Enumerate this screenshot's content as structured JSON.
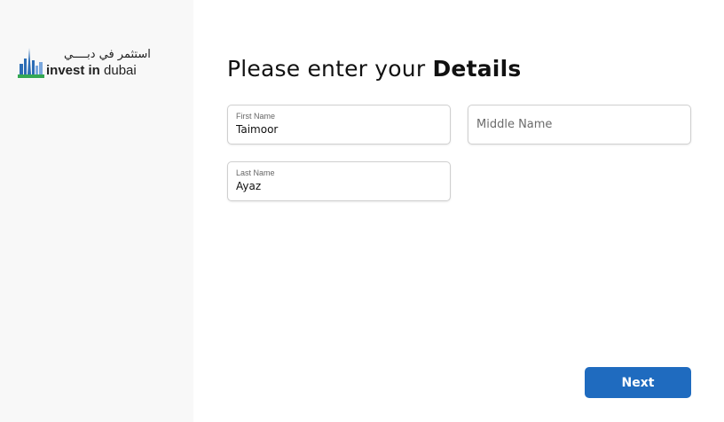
{
  "brand": {
    "arabic": "استثمر في دبــــي",
    "latin_bold": "invest in",
    "latin_regular": " dubai"
  },
  "form": {
    "heading_regular": "Please enter your ",
    "heading_bold": "Details",
    "first_name": {
      "label": "First Name",
      "value": "Taimoor"
    },
    "middle_name": {
      "placeholder": "Middle Name",
      "value": ""
    },
    "last_name": {
      "label": "Last Name",
      "value": "Ayaz"
    }
  },
  "actions": {
    "next_label": "Next"
  },
  "colors": {
    "accent": "#1f6bbf",
    "sidebar_bg": "#f8f8f8"
  }
}
